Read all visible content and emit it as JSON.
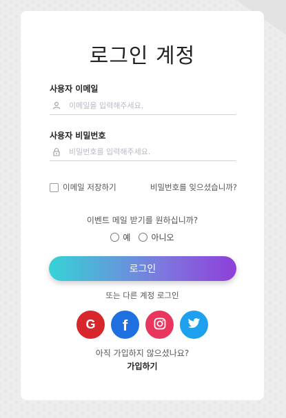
{
  "title": "로그인 계정",
  "email": {
    "label": "사용자 이메일",
    "placeholder": "이메일을 입력해주세요.",
    "icon": "user-icon"
  },
  "password": {
    "label": "사용자 비밀번호",
    "placeholder": "비밀번호를 입력해주세요.",
    "icon": "lock-icon"
  },
  "remember_label": "이메일 저장하기",
  "forgot_label": "비밀번호를 잊으셨습니까?",
  "event_question": "이벤트 메일 받기를 원하십니까?",
  "radio_options": [
    "예",
    "아니오"
  ],
  "login_button": "로그인",
  "alt_login_label": "또는 다른 계정 로그인",
  "social": [
    {
      "name": "google",
      "glyph": "G",
      "color": "#d7262c"
    },
    {
      "name": "facebook",
      "glyph": "f",
      "color": "#1e6fe0"
    },
    {
      "name": "instagram",
      "glyph": "",
      "color": "#e8365f"
    },
    {
      "name": "twitter",
      "glyph": "",
      "color": "#1da1ee"
    }
  ],
  "signup_question": "아직 가입하지 않으셨나요?",
  "signup_link": "가입하기"
}
